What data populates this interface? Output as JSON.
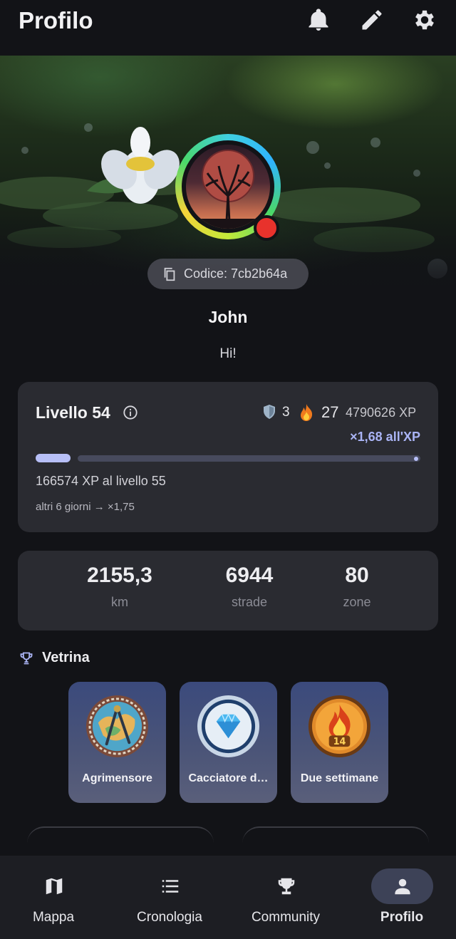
{
  "header": {
    "title": "Profilo"
  },
  "profile": {
    "code_label": "Codice: 7cb2b64a",
    "name": "John",
    "bio": "Hi!"
  },
  "level": {
    "title": "Livello 54",
    "shields": "3",
    "streak": "27",
    "xp_total": "4790626 XP",
    "multiplier": "×1,68 all'XP",
    "progress_fraction": 0.09,
    "xp_to_next": "166574 XP al livello 55",
    "next_multiplier_note": "altri 6 giorni → ×1,75"
  },
  "stats": [
    {
      "value": "2155,3",
      "label": "km"
    },
    {
      "value": "6944",
      "label": "strade"
    },
    {
      "value": "80",
      "label": "zone"
    }
  ],
  "showcase": {
    "title": "Vetrina",
    "badges": [
      {
        "label": "Agrimensore",
        "icon": "compass-map-medal-icon"
      },
      {
        "label": "Cacciatore d…",
        "icon": "diamond-medal-icon"
      },
      {
        "label": "Due settimane",
        "icon": "flame-14-medal-icon"
      }
    ]
  },
  "nav": {
    "items": [
      {
        "label": "Mappa",
        "icon": "map-icon"
      },
      {
        "label": "Cronologia",
        "icon": "list-icon"
      },
      {
        "label": "Community",
        "icon": "trophy-icon"
      },
      {
        "label": "Profilo",
        "icon": "person-icon"
      }
    ],
    "active": "Profilo"
  },
  "colors": {
    "background": "#121317",
    "card": "#2a2b31",
    "accent": "#aab4f5",
    "status_red": "#e8322c"
  }
}
